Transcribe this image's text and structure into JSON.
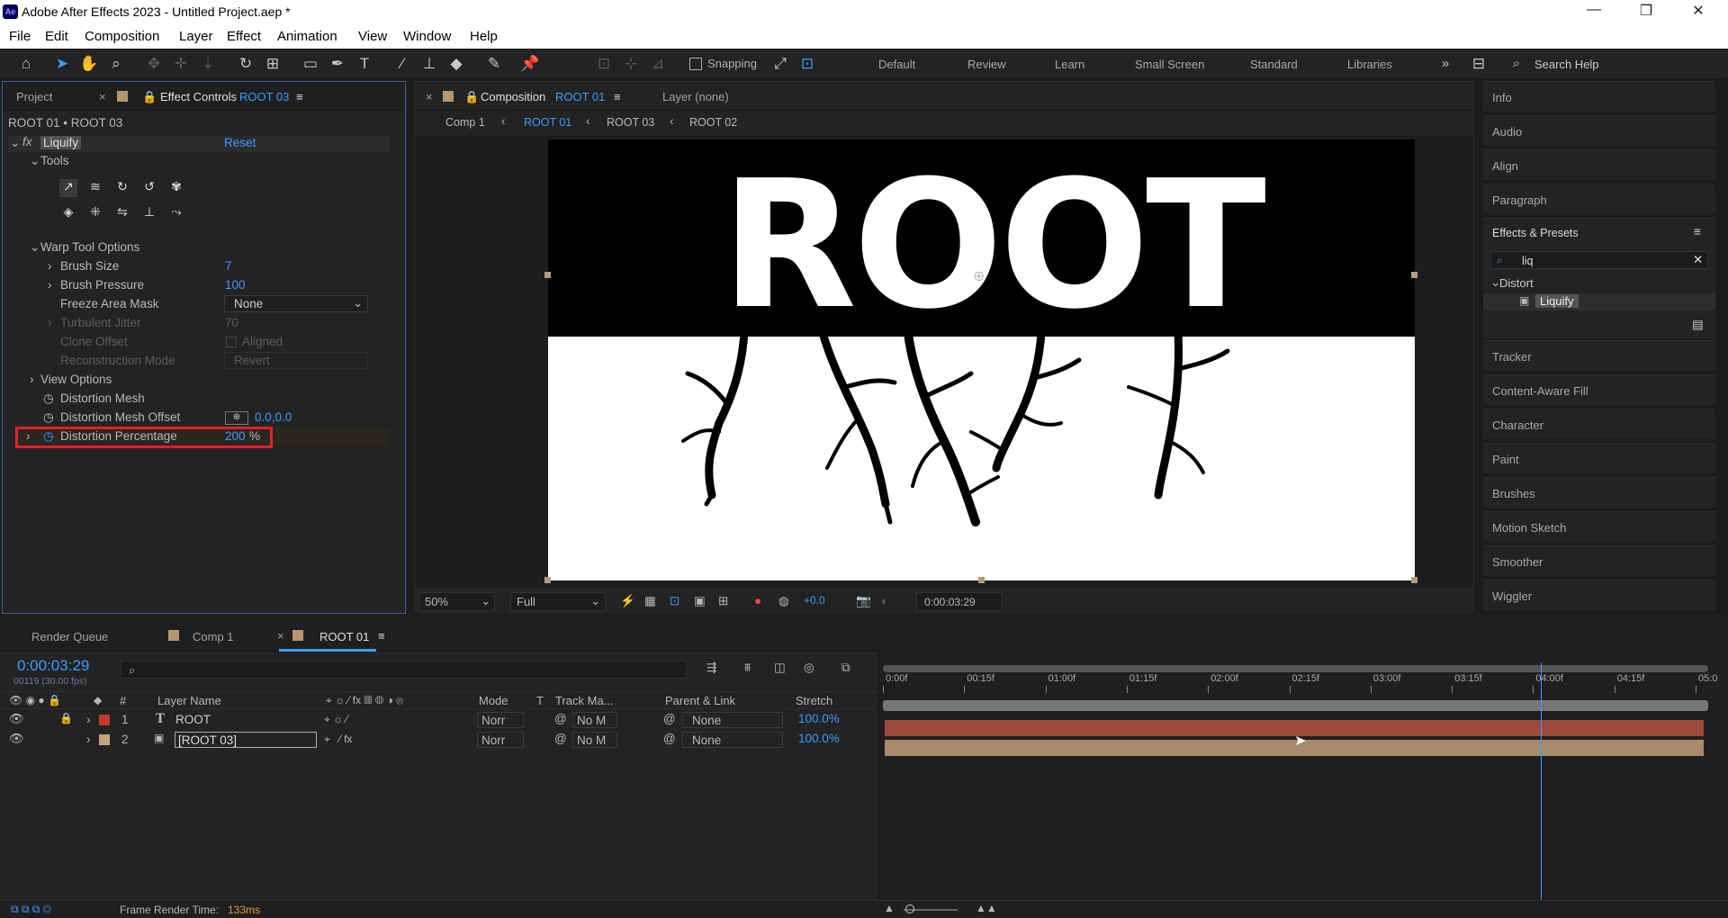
{
  "app": {
    "title": "Adobe After Effects 2023 - Untitled Project.aep *",
    "icon_text": "Ae"
  },
  "window_controls": {
    "minimize": "—",
    "restore": "❐",
    "close": "✕"
  },
  "menu": [
    "File",
    "Edit",
    "Composition",
    "Layer",
    "Effect",
    "Animation",
    "View",
    "Window",
    "Help"
  ],
  "toolbar": {
    "snapping": "Snapping",
    "workspaces": [
      "Default",
      "Review",
      "Learn",
      "Small Screen",
      "Standard",
      "Libraries"
    ],
    "search_placeholder": "Search Help"
  },
  "project_tab": "Project",
  "effect_controls": {
    "tab": "Effect Controls",
    "tab_layer": "ROOT 03",
    "breadcrumb": "ROOT 01 • ROOT 03",
    "effect": "Liquify",
    "reset": "Reset",
    "tools": "Tools",
    "warp": "Warp Tool Options",
    "props": [
      {
        "label": "Brush Size",
        "value": "7"
      },
      {
        "label": "Brush Pressure",
        "value": "100"
      },
      {
        "label": "Freeze Area Mask",
        "value": "None"
      },
      {
        "label": "Turbulent Jitter",
        "value": "70"
      },
      {
        "label": "Clone Offset",
        "value": "Aligned"
      },
      {
        "label": "Reconstruction Mode",
        "value": "Revert"
      }
    ],
    "view_options": "View Options",
    "distortion_mesh": "Distortion Mesh",
    "mesh_offset": "Distortion Mesh Offset",
    "mesh_offset_value": "0.0,0.0",
    "pct_label": "Distortion Percentage",
    "pct_value": "200",
    "pct_unit": "%"
  },
  "composition": {
    "tab": "Composition",
    "tab_comp": "ROOT 01",
    "layer_tab": "Layer (none)",
    "breadcrumbs": [
      "Comp 1",
      "ROOT 01",
      "ROOT 03",
      "ROOT 02"
    ],
    "canvas_text": "ROOT",
    "zoom": "50%",
    "resolution": "Full",
    "exposure": "+0.0",
    "timecode": "0:00:03:29"
  },
  "right_panel": {
    "items_top": [
      "Info",
      "Audio",
      "Align",
      "Paragraph"
    ],
    "effects_presets": "Effects & Presets",
    "search": "liq",
    "category": "Distort",
    "result": "Liquify",
    "items_bottom": [
      "Tracker",
      "Content-Aware Fill",
      "Character",
      "Paint",
      "Brushes",
      "Motion Sketch",
      "Smoother",
      "Wiggler"
    ]
  },
  "timeline": {
    "tabs": [
      "Render Queue",
      "Comp 1",
      "ROOT 01"
    ],
    "timecode": "0:00:03:29",
    "frames": "00119 (30.00 fps)",
    "headers": {
      "num": "#",
      "name": "Layer Name",
      "mode": "Mode",
      "t": "T",
      "track": "Track Ma...",
      "parent": "Parent & Link",
      "stretch": "Stretch"
    },
    "ruler": [
      "0:00f",
      "00:15f",
      "01:00f",
      "01:15f",
      "02:00f",
      "02:15f",
      "03:00f",
      "03:15f",
      "04:00f",
      "04:15f",
      "05:0"
    ],
    "layers": [
      {
        "num": "1",
        "type": "T",
        "name": "ROOT",
        "mode": "Norr",
        "track": "No M",
        "parent": "None",
        "stretch": "100.0%",
        "color": "#c0392b",
        "bar": "#9c4a3a"
      },
      {
        "num": "2",
        "type": "comp",
        "name": "[ROOT 03]",
        "mode": "Norr",
        "track": "No M",
        "parent": "None",
        "stretch": "100.0%",
        "color": "#c5a47c",
        "bar": "#a88a6c"
      }
    ],
    "playhead_fraction": 0.797
  },
  "status": {
    "label": "Frame Render Time:",
    "value": "133ms"
  },
  "colors": {
    "accent": "#3a9cff",
    "highlight": "#e0202a"
  }
}
